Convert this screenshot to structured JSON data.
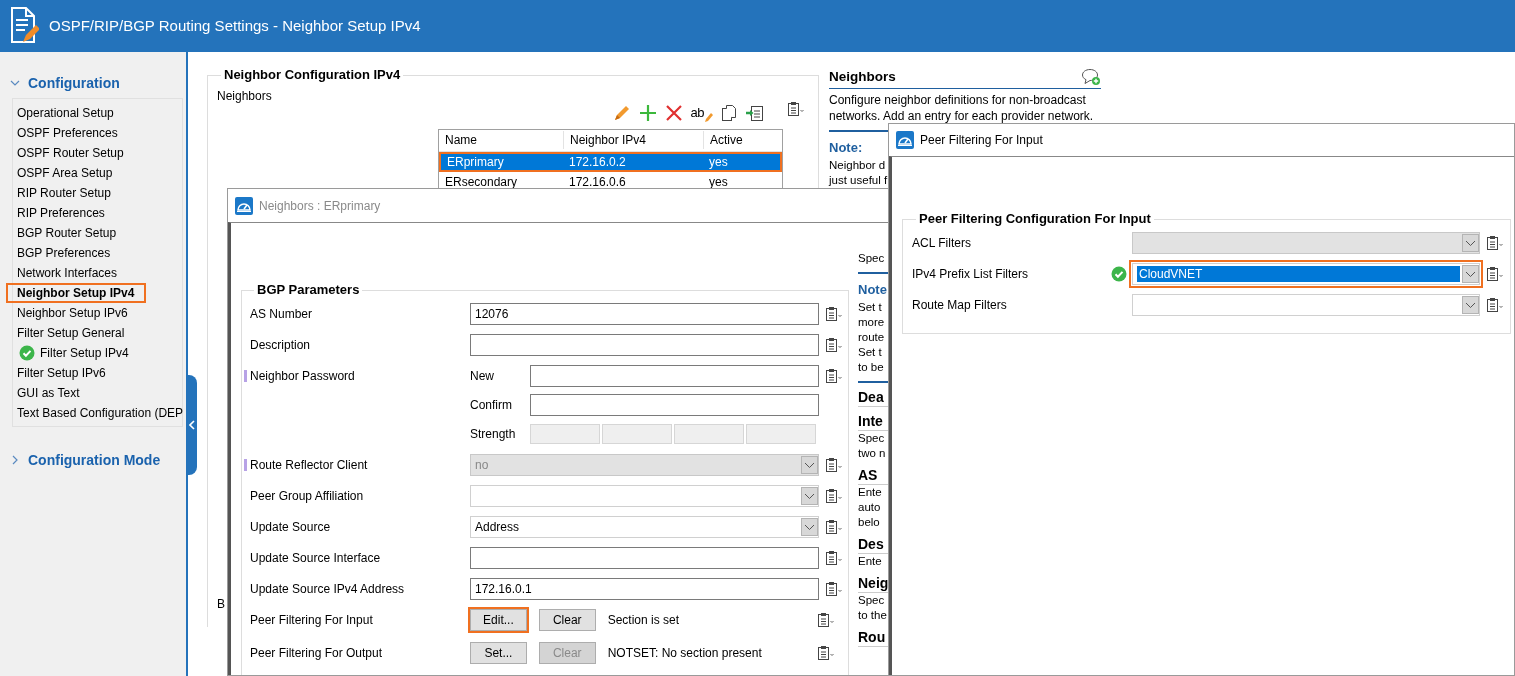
{
  "window": {
    "title": "OSPF/RIP/BGP Routing Settings - Neighbor Setup IPv4"
  },
  "sidebar": {
    "sections": [
      {
        "title": "Configuration",
        "expanded": true,
        "items": [
          {
            "label": "Operational Setup",
            "selected": false,
            "valid": false
          },
          {
            "label": "OSPF Preferences",
            "selected": false,
            "valid": false
          },
          {
            "label": "OSPF Router Setup",
            "selected": false,
            "valid": false
          },
          {
            "label": "OSPF Area Setup",
            "selected": false,
            "valid": false
          },
          {
            "label": "RIP Router Setup",
            "selected": false,
            "valid": false
          },
          {
            "label": "RIP Preferences",
            "selected": false,
            "valid": false
          },
          {
            "label": "BGP Router Setup",
            "selected": false,
            "valid": false
          },
          {
            "label": "BGP Preferences",
            "selected": false,
            "valid": false
          },
          {
            "label": "Network Interfaces",
            "selected": false,
            "valid": false
          },
          {
            "label": "Neighbor Setup IPv4",
            "selected": true,
            "valid": false
          },
          {
            "label": "Neighbor Setup IPv6",
            "selected": false,
            "valid": false
          },
          {
            "label": "Filter Setup General",
            "selected": false,
            "valid": false
          },
          {
            "label": "Filter Setup IPv4",
            "selected": false,
            "valid": true
          },
          {
            "label": "Filter Setup IPv6",
            "selected": false,
            "valid": false
          },
          {
            "label": "GUI as Text",
            "selected": false,
            "valid": false
          },
          {
            "label": "Text Based Configuration (DEP",
            "selected": false,
            "valid": false
          }
        ]
      },
      {
        "title": "Configuration Mode",
        "expanded": false
      }
    ]
  },
  "main": {
    "group_title": "Neighbor Configuration IPv4",
    "neighbors_label": "Neighbors",
    "toolbar": [
      {
        "kind": "edit"
      },
      {
        "kind": "add"
      },
      {
        "kind": "delete"
      },
      {
        "kind": "rename",
        "text": "ab"
      },
      {
        "kind": "copy"
      },
      {
        "kind": "paste"
      },
      {
        "kind": "menu"
      }
    ],
    "columns": [
      "Name",
      "Neighbor IPv4",
      "Active"
    ],
    "rows": [
      {
        "cells": [
          "ERprimary",
          "172.16.0.2",
          "yes"
        ],
        "selected": true
      },
      {
        "cells": [
          "ERsecondary",
          "172.16.0.6",
          "yes"
        ],
        "selected": false
      }
    ],
    "hidden_label": "B"
  },
  "help": {
    "title": "Neighbors",
    "text": "Configure neighbor definitions for non-broadcast networks. Add an entry for each provider network.",
    "note_title": "Note:",
    "note_lines": [
      "Neighbor d",
      "just useful f"
    ]
  },
  "dialog": {
    "title": "Neighbors : ERprimary",
    "group_title": "BGP Parameters",
    "fields": [
      {
        "kind": "text",
        "label": "AS Number",
        "value": "12076",
        "marked": false
      },
      {
        "kind": "text",
        "label": "Description",
        "marked": false
      },
      {
        "kind": "password",
        "label": "Neighbor Password",
        "marked": true,
        "new_label": "New",
        "confirm_label": "Confirm",
        "strength_label": "Strength"
      },
      {
        "kind": "select",
        "label": "Route Reflector Client",
        "value": "no",
        "disabled": true,
        "marked": true
      },
      {
        "kind": "select",
        "label": "Peer Group Affiliation",
        "disabled": false,
        "marked": false
      },
      {
        "kind": "select",
        "label": "Update Source",
        "value": "Address",
        "disabled": false,
        "marked": false
      },
      {
        "kind": "text",
        "label": "Update Source Interface",
        "marked": false
      },
      {
        "kind": "text",
        "label": "Update Source IPv4 Address",
        "value": "172.16.0.1",
        "marked": false
      },
      {
        "kind": "section",
        "label": "Peer Filtering For Input",
        "edit_button": "Edit...",
        "clear_button": "Clear",
        "clear_disabled": false,
        "highlighted": true,
        "status": "Section is set",
        "marked": false
      },
      {
        "kind": "section",
        "label": "Peer Filtering For Output",
        "edit_button": "Set...",
        "clear_button": "Clear",
        "clear_disabled": true,
        "highlighted": false,
        "status": "NOTSET: No section present",
        "marked": false
      }
    ],
    "help_fragments": [
      {
        "kind": "text",
        "text": "Spec"
      },
      {
        "kind": "rule"
      },
      {
        "kind": "note",
        "text": "Note"
      },
      {
        "kind": "text",
        "text": "Set t"
      },
      {
        "kind": "text",
        "text": "more"
      },
      {
        "kind": "text",
        "text": "route"
      },
      {
        "kind": "text",
        "text": "Set t"
      },
      {
        "kind": "text",
        "text": "to be"
      },
      {
        "kind": "rule"
      },
      {
        "kind": "heading",
        "text": "Dea"
      },
      {
        "kind": "heading",
        "text": "Inte"
      },
      {
        "kind": "text",
        "text": "Spec"
      },
      {
        "kind": "text",
        "text": "two n"
      },
      {
        "kind": "heading",
        "text": "AS"
      },
      {
        "kind": "text",
        "text": "Ente"
      },
      {
        "kind": "text",
        "text": "auto"
      },
      {
        "kind": "text",
        "text": "belo"
      },
      {
        "kind": "heading",
        "text": "Des"
      },
      {
        "kind": "text",
        "text": "Ente"
      },
      {
        "kind": "heading",
        "text": "Neig"
      },
      {
        "kind": "text",
        "text": "Spec"
      },
      {
        "kind": "text",
        "text": "to the"
      },
      {
        "kind": "heading",
        "text": "Rou"
      }
    ]
  },
  "peer_window": {
    "title": "Peer Filtering For Input",
    "group_title": "Peer Filtering Configuration For Input",
    "fields": [
      {
        "label": "ACL Filters",
        "disabled": true,
        "valid": false,
        "highlighted": false
      },
      {
        "label": "IPv4 Prefix List Filters",
        "value": "CloudVNET",
        "disabled": false,
        "valid": true,
        "highlighted": true
      },
      {
        "label": "Route Map Filters",
        "disabled": false,
        "valid": false,
        "highlighted": false
      }
    ]
  }
}
